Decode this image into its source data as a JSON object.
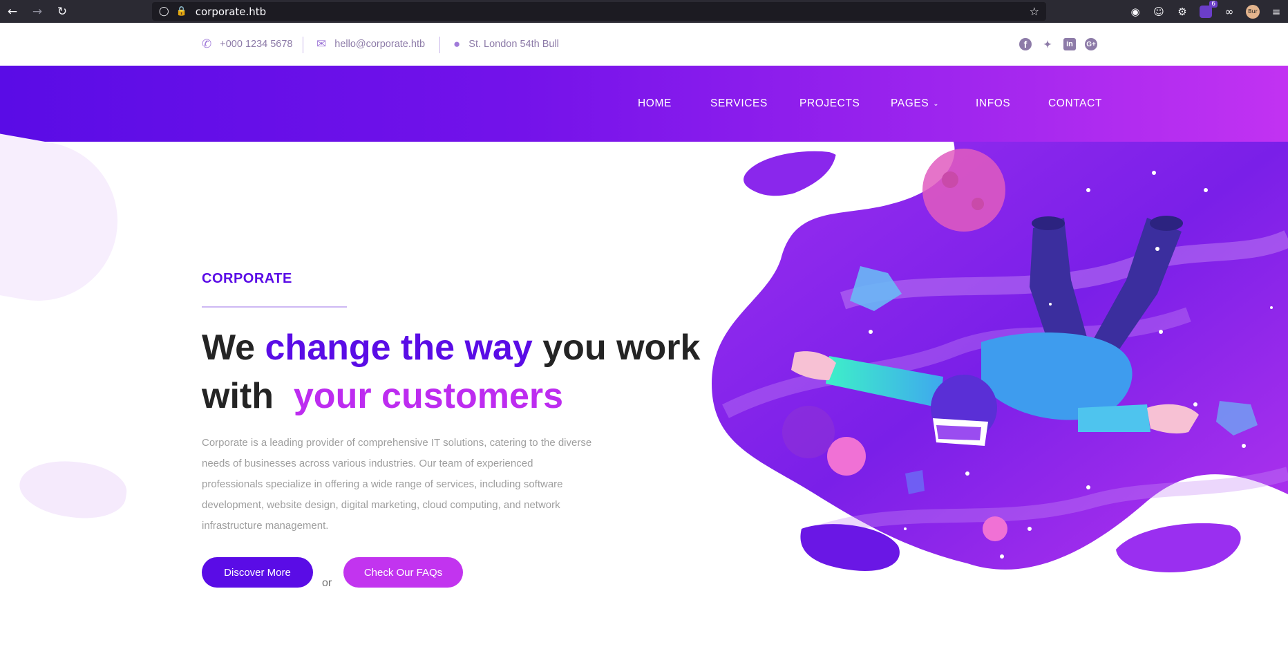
{
  "browser": {
    "url": "corporate.htb",
    "extension_badge": "6",
    "avatar_label": "Bur"
  },
  "topbar": {
    "phone": "+000 1234 5678",
    "email": "hello@corporate.htb",
    "address": "St. London 54th Bull",
    "social": [
      "facebook-icon",
      "twitter-icon",
      "linkedin-icon",
      "google-plus-icon"
    ]
  },
  "nav": {
    "items": [
      "HOME",
      "SERVICES",
      "PROJECTS",
      "PAGES",
      "INFOS",
      "CONTACT"
    ]
  },
  "hero": {
    "eyebrow": "CORPORATE",
    "title_part1": "We",
    "title_part2": "change the way",
    "title_part3": "you work with",
    "title_part4": "your customers",
    "description": "Corporate is a leading provider of comprehensive IT solutions, catering to the diverse needs of businesses across various industries. Our team of experienced professionals specialize in offering a wide range of services, including software development, website design, digital marketing, cloud computing, and network infrastructure management.",
    "primary_button": "Discover More",
    "or_label": "or",
    "secondary_button": "Check Our FAQs"
  },
  "colors": {
    "brand_purple": "#5a0ce6",
    "brand_pink": "#c234ef",
    "header_gradient_start": "#5a0ce6",
    "header_gradient_end": "#c232f2"
  }
}
